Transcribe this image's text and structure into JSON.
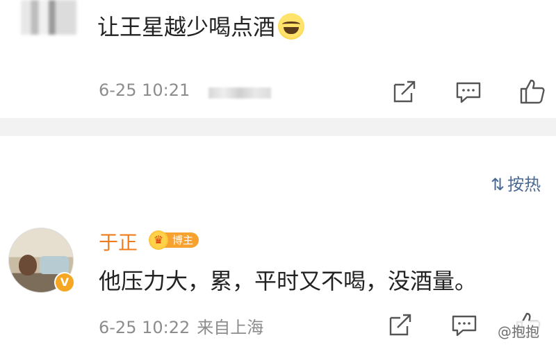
{
  "comment1": {
    "text": "让王星越少喝点酒",
    "emoji": "laughing-crying-emoji",
    "timestamp": "6-25 10:21"
  },
  "sort": {
    "icon": "sort-icon",
    "icon_glyph": "⇅",
    "label": "按热"
  },
  "comment2": {
    "author": "于正",
    "badge_label": "博主",
    "verified_glyph": "V",
    "text": "他压力大，累，平时又不喝，没酒量。",
    "timestamp": "6-25 10:22",
    "location": "来自上海"
  },
  "watermark": "@抱抱",
  "colors": {
    "author": "#f07b1a",
    "sort_link": "#4a6a93",
    "meta": "#8c8c8c",
    "badge": "#f7a12e"
  },
  "icons": [
    "share-icon",
    "comment-icon",
    "like-icon"
  ]
}
